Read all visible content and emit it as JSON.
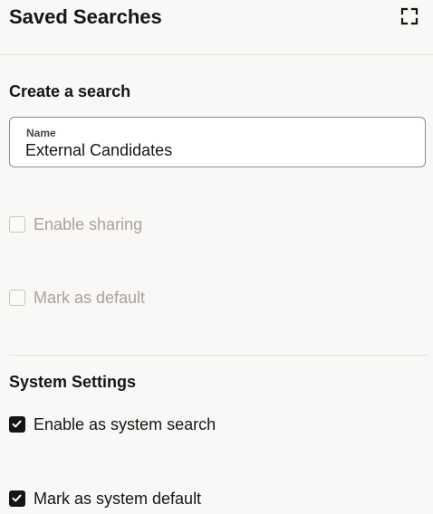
{
  "header": {
    "title": "Saved Searches",
    "expand_icon": "expand-icon"
  },
  "create_section": {
    "heading": "Create a search",
    "name_field": {
      "label": "Name",
      "value": "External Candidates"
    },
    "enable_sharing": {
      "label": "Enable sharing",
      "checked": false,
      "disabled": true
    },
    "mark_default": {
      "label": "Mark as default",
      "checked": false,
      "disabled": true
    }
  },
  "system_section": {
    "heading": "System Settings",
    "enable_system_search": {
      "label": "Enable as system search",
      "checked": true
    },
    "mark_system_default": {
      "label": "Mark as system default",
      "checked": true
    }
  },
  "colors": {
    "background": "#f9f8f6",
    "text": "#161513",
    "disabled_text": "#a7a39e",
    "checkbox_checked": "#161513"
  }
}
